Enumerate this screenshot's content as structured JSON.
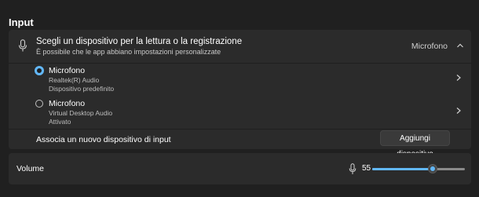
{
  "section": {
    "title": "Input"
  },
  "device_chooser": {
    "title": "Scegli un dispositivo per la lettura o la registrazione",
    "subtitle": "È possibile che le app abbiano impostazioni personalizzate",
    "selected_value": "Microfono",
    "icon": "microphone-icon",
    "expand_icon": "chevron-up-icon"
  },
  "devices": [
    {
      "name": "Microfono",
      "line1": "Realtek(R) Audio",
      "line2": "Dispositivo predefinito",
      "selected": true
    },
    {
      "name": "Microfono",
      "line1": "Virtual Desktop Audio",
      "line2": "Attivato",
      "selected": false
    }
  ],
  "associate": {
    "label": "Associa un nuovo dispositivo di input",
    "button_label": "Aggiungi dispositivo"
  },
  "volume": {
    "label": "Volume",
    "value": "55",
    "level": 0.55
  },
  "colors": {
    "background": "#202020",
    "card": "#2b2b2b",
    "accent": "#62b7f7"
  }
}
